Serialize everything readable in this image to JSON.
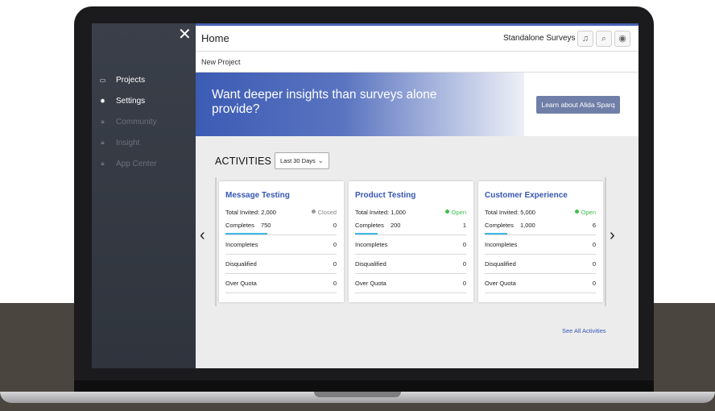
{
  "sidebar": {
    "close_icon": "close-icon",
    "items": [
      {
        "label": "Projects",
        "icon": "folder-icon",
        "locked": false
      },
      {
        "label": "Settings",
        "icon": "gear-icon",
        "locked": false
      },
      {
        "label": "Community",
        "icon": "lock-icon",
        "locked": true
      },
      {
        "label": "Insight",
        "icon": "lock-icon",
        "locked": true
      },
      {
        "label": "App Center",
        "icon": "lock-icon",
        "locked": true
      }
    ]
  },
  "header": {
    "title": "Home",
    "brand": "Standalone Surveys",
    "icons": [
      "bell-icon",
      "search-icon",
      "user-icon"
    ]
  },
  "breadcrumb": {
    "label": "New Project"
  },
  "banner": {
    "text": "Want deeper insights than surveys alone provide?",
    "button_label": "Learn about Alida Sparq"
  },
  "activities": {
    "title": "ACTIVITIES",
    "period": "Last 30 Days",
    "see_all": "See All Activities",
    "cards": [
      {
        "title": "Message Testing",
        "total_invited_label": "Total Invited:",
        "total_invited": "2,000",
        "status": "Closed",
        "completes_label": "Completes",
        "completes": "750",
        "completes_right": "0",
        "completes_progress": 0.375,
        "incompletes_label": "Incompletes",
        "incompletes": "0",
        "disqualified_label": "Disqualified",
        "disqualified": "0",
        "over_quota_label": "Over Quota",
        "over_quota": "0"
      },
      {
        "title": "Product Testing",
        "total_invited_label": "Total Invited:",
        "total_invited": "1,000",
        "status": "Open",
        "completes_label": "Completes",
        "completes": "200",
        "completes_right": "1",
        "completes_progress": 0.2,
        "incompletes_label": "Incompletes",
        "incompletes": "0",
        "disqualified_label": "Disqualified",
        "disqualified": "0",
        "over_quota_label": "Over Quota",
        "over_quota": "0"
      },
      {
        "title": "Customer Experience",
        "total_invited_label": "Total Invited:",
        "total_invited": "5,000",
        "status": "Open",
        "completes_label": "Completes",
        "completes": "1,000",
        "completes_right": "6",
        "completes_progress": 0.2,
        "incompletes_label": "Incompletes",
        "incompletes": "0",
        "disqualified_label": "Disqualified",
        "disqualified": "0",
        "over_quota_label": "Over Quota",
        "over_quota": "0"
      }
    ]
  },
  "colors": {
    "accent": "#3657b3",
    "open": "#3fbf4b",
    "closed": "#888888",
    "progress": "#3dbbe5",
    "sidebar": "#343942"
  }
}
